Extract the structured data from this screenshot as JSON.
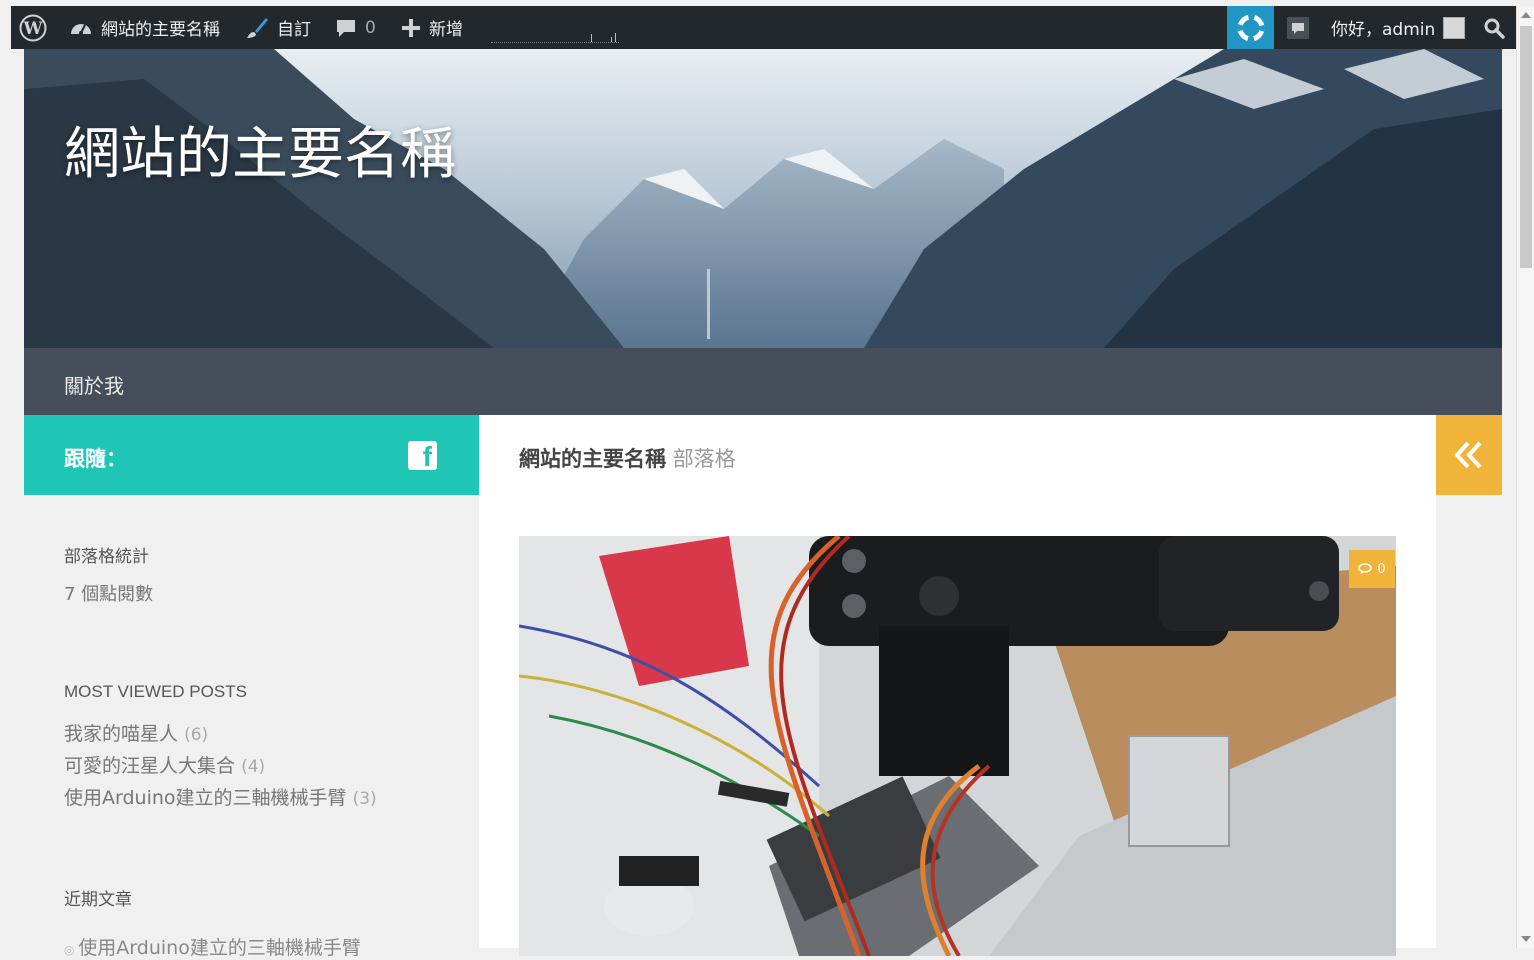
{
  "adminbar": {
    "site_name": "網站的主要名稱",
    "customize": "自訂",
    "comments_count": "0",
    "new_label": "新增",
    "greeting": "你好，admin"
  },
  "header": {
    "site_title": "網站的主要名稱"
  },
  "nav": {
    "items": [
      {
        "label": "關於我"
      }
    ]
  },
  "follow": {
    "label": "跟隨："
  },
  "page_title": {
    "site": "網站的主要名稱",
    "suffix": "部落格"
  },
  "sidebar": {
    "stats": {
      "title": "部落格統計",
      "views": "7 個點閱數"
    },
    "most_viewed": {
      "title": "MOST VIEWED POSTS",
      "items": [
        {
          "title": "我家的喵星人",
          "count": "(6)"
        },
        {
          "title": "可愛的汪星人大集合",
          "count": "(4)"
        },
        {
          "title": "使用Arduino建立的三軸機械手臂",
          "count": "(3)"
        }
      ]
    },
    "recent": {
      "title": "近期文章",
      "items": [
        {
          "title": "使用Arduino建立的三軸機械手臂"
        }
      ]
    }
  },
  "post": {
    "comment_count": "0"
  },
  "colors": {
    "adminbar_bg": "#23282d",
    "support_blue": "#2196c4",
    "nav_bg": "#474e5b",
    "teal": "#1fc6b6",
    "accent_yellow": "#f0b43a"
  },
  "icons": [
    "wordpress-logo-icon",
    "dashboard-icon",
    "brush-icon",
    "comment-bubble-icon",
    "plus-icon",
    "lifebuoy-icon",
    "notification-icon",
    "search-icon",
    "facebook-icon",
    "double-chevron-left-icon",
    "comments-icon"
  ]
}
